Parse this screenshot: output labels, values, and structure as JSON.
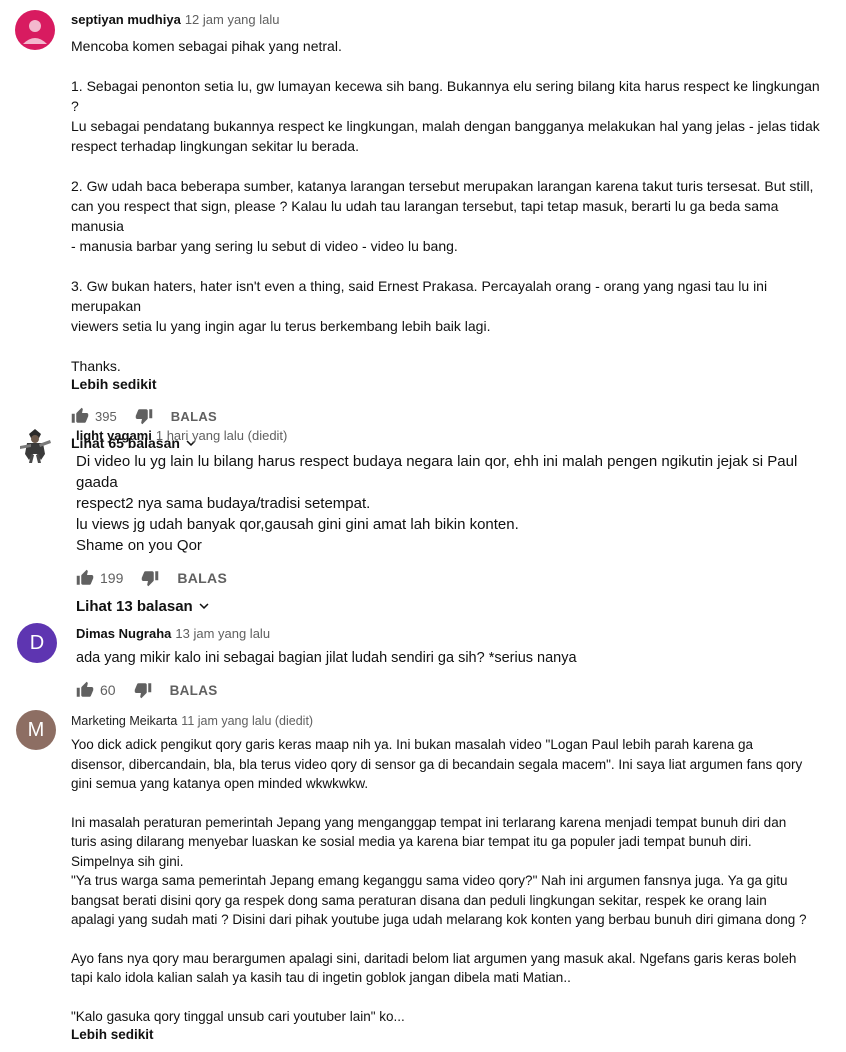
{
  "comments": [
    {
      "author": "septiyan mudhiya",
      "time": "12 jam yang lalu",
      "avatar_color": "#d81b60",
      "paragraphs": [
        "Mencoba komen sebagai pihak yang netral.",
        "1. Sebagai penonton setia lu, gw lumayan kecewa sih bang. Bukannya elu sering bilang kita harus respect ke lingkungan ?\nLu sebagai pendatang bukannya respect ke lingkungan, malah dengan bangganya melakukan hal yang jelas - jelas tidak\nrespect terhadap lingkungan sekitar lu berada.",
        "2. Gw udah baca beberapa sumber, katanya larangan tersebut merupakan larangan karena takut turis tersesat. But still,\ncan you respect that sign, please ? Kalau lu udah tau larangan tersebut, tapi tetap masuk, berarti lu ga beda sama manusia\n- manusia barbar yang sering lu sebut di video - video lu bang.",
        "3. Gw bukan haters, hater isn't even a thing, said Ernest Prakasa. Percayalah orang - orang yang ngasi tau lu ini merupakan\nviewers setia lu yang ingin agar lu terus berkembang lebih baik lagi.",
        "Thanks."
      ],
      "read_less": "Lebih sedikit",
      "likes": "395",
      "reply_label": "BALAS",
      "view_replies": "Lihat 65 balasan"
    },
    {
      "author": "light yagami",
      "time": "1 hari yang lalu (diedit)",
      "paragraphs": [
        "Di video lu yg lain lu bilang harus respect budaya negara lain qor, ehh ini malah pengen ngikutin jejak si Paul gaada\nrespect2 nya sama budaya/tradisi setempat.\nlu views jg udah banyak qor,gausah gini gini amat lah bikin konten.\nShame on you Qor"
      ],
      "likes": "199",
      "reply_label": "BALAS",
      "view_replies": "Lihat 13 balasan"
    },
    {
      "author": "Dimas Nugraha",
      "time": "13 jam yang lalu",
      "avatar_letter": "D",
      "avatar_color": "#5e35b1",
      "paragraphs": [
        "ada yang mikir kalo ini sebagai bagian jilat ludah sendiri ga sih? *serius nanya"
      ],
      "likes": "60",
      "reply_label": "BALAS"
    },
    {
      "author": "Marketing Meikarta",
      "time": "11 jam yang lalu (diedit)",
      "avatar_letter": "M",
      "avatar_color": "#8d6e63",
      "paragraphs": [
        "Yoo dick adick pengikut qory garis keras maap nih ya. Ini bukan masalah video \"Logan Paul lebih parah karena ga\ndisensor, dibercandain, bla, bla terus video qory di sensor ga di becandain segala macem\". Ini saya liat argumen fans qory\ngini semua yang katanya open minded wkwkwkw.",
        "Ini masalah peraturan pemerintah Jepang yang menganggap tempat ini terlarang karena menjadi  tempat bunuh diri dan\nturis asing dilarang menyebar luaskan ke sosial media ya karena biar tempat itu ga populer jadi tempat bunuh diri.\nSimpelnya sih gini.\n\"Ya trus warga sama pemerintah Jepang emang keganggu sama video qory?\" Nah ini argumen fansnya juga. Ya ga gitu\nbangsat berati disini qory ga respek dong sama peraturan disana dan peduli lingkungan sekitar, respek ke orang lain\napalagi yang sudah mati ? Disini dari pihak youtube juga udah melarang kok konten yang berbau bunuh diri gimana dong ?",
        "Ayo fans nya qory mau berargumen apalagi sini, daritadi belom liat argumen yang masuk akal. Ngefans garis keras boleh\ntapi kalo idola kalian salah ya kasih tau di ingetin goblok jangan dibela mati Matian..",
        "\"Kalo gasuka qory tinggal unsub cari youtuber lain\" ko..."
      ],
      "read_less": "Lebih sedikit"
    }
  ]
}
